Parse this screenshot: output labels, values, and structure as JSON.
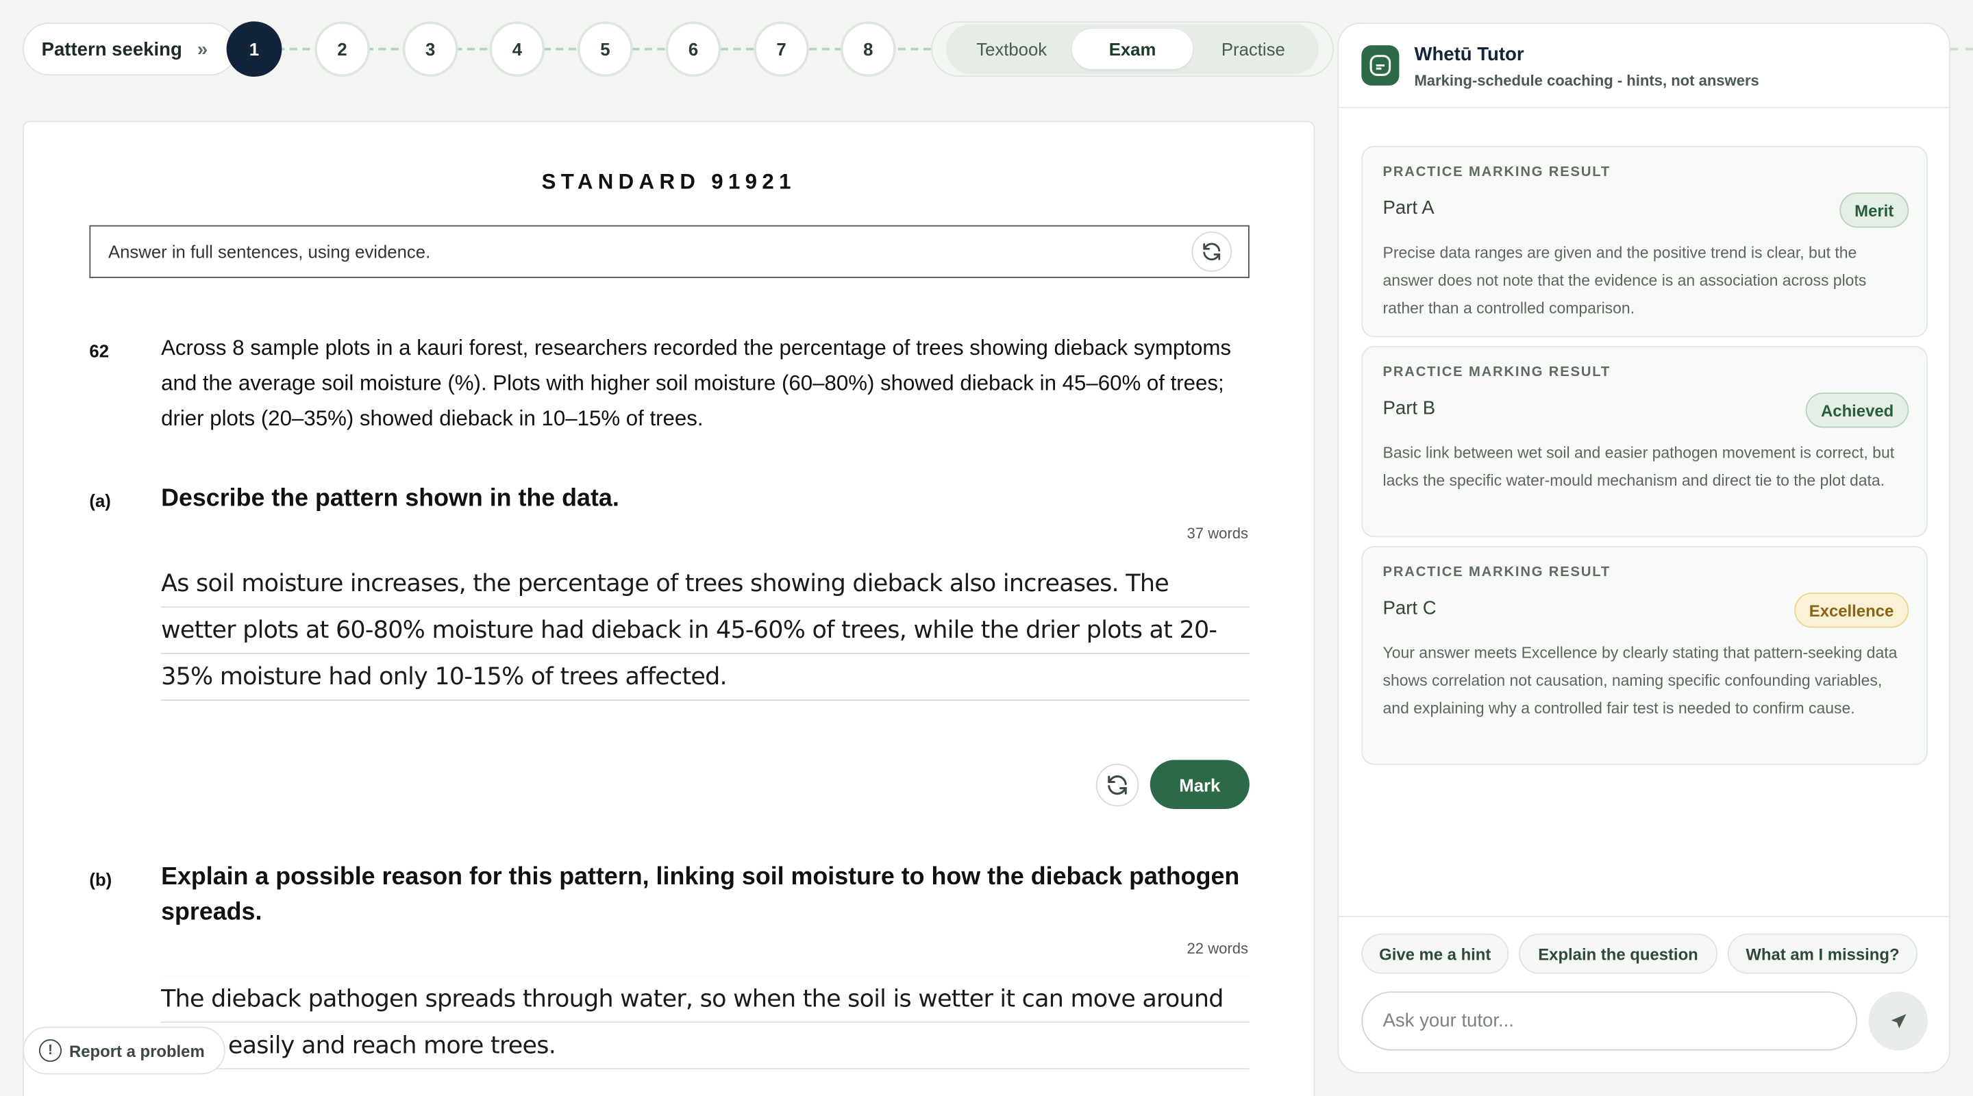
{
  "topic": {
    "label": "Pattern seeking",
    "chevron": "»"
  },
  "steps": [
    "1",
    "2",
    "3",
    "4",
    "5",
    "6",
    "7",
    "8"
  ],
  "modes": [
    "Textbook",
    "Exam",
    "Practise"
  ],
  "paper": {
    "standard_title": "STANDARD 91921",
    "instruction": "Answer in full sentences, using evidence.",
    "question_number": "62",
    "question_text": "Across 8 sample plots in a kauri forest, researchers recorded the percentage of trees showing dieback symptoms and the average soil moisture (%). Plots with higher soil moisture (60–80%) showed dieback in 45–60% of trees; drier plots (20–35%) showed dieback in 10–15% of trees.",
    "parts": [
      {
        "label": "(a)",
        "question": "Describe the pattern shown in the data.",
        "word_count": "37 words",
        "answer": "As soil moisture increases, the percentage of trees showing dieback also increases. The wetter plots at 60-80% moisture had dieback in 45-60% of trees, while the drier plots at 20-35% moisture had only 10-15% of trees affected.",
        "mark_label": "Mark"
      },
      {
        "label": "(b)",
        "question": "Explain a possible reason for this pattern, linking soil moisture to how the dieback pathogen spreads.",
        "word_count": "22 words",
        "answer": "The dieback pathogen spreads through water, so when the soil is wetter it can move around more easily and reach more trees."
      }
    ]
  },
  "report": {
    "label": "Report a problem",
    "icon": "!"
  },
  "tutor": {
    "name": "Whetū Tutor",
    "subtitle": "Marking-schedule coaching - hints, not answers",
    "results": [
      {
        "kicker": "PRACTICE MARKING RESULT",
        "title": "Part A",
        "badge": "Merit",
        "body": "Precise data ranges are given and the positive trend is clear, but the answer does not note that the evidence is an association across plots rather than a controlled comparison."
      },
      {
        "kicker": "PRACTICE MARKING RESULT",
        "title": "Part B",
        "badge": "Achieved",
        "body": "Basic link between wet soil and easier pathogen movement is correct, but lacks the specific water-mould mechanism and direct tie to the plot data."
      },
      {
        "kicker": "PRACTICE MARKING RESULT",
        "title": "Part C",
        "badge": "Excellence",
        "body": "Your answer meets Excellence by clearly stating that pattern-seeking data shows correlation not causation, naming specific confounding variables, and explaining why a controlled fair test is needed to confirm cause."
      }
    ],
    "chips": [
      "Give me a hint",
      "Explain the question",
      "What am I missing?"
    ],
    "ask_placeholder": "Ask your tutor..."
  },
  "colors": {
    "accent": "#2c6a47",
    "active_step": "#13233a",
    "background": "#f2f5f1"
  }
}
